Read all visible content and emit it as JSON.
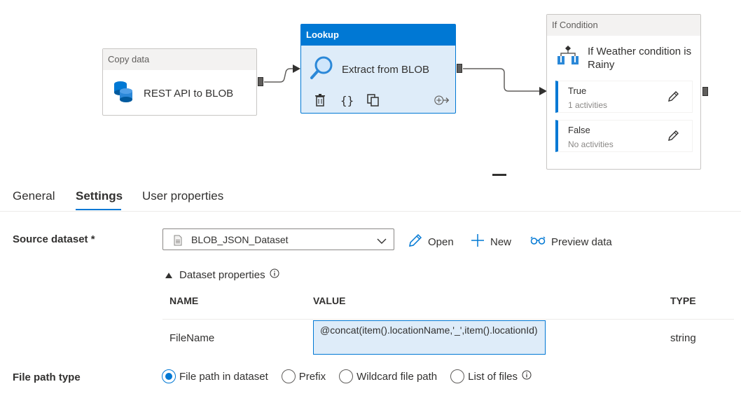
{
  "canvas": {
    "copy_node": {
      "header": "Copy data",
      "title": "REST API to BLOB",
      "icon": "database-copy-icon"
    },
    "lookup_node": {
      "header": "Lookup",
      "title": "Extract from BLOB",
      "icon": "magnifier-icon",
      "actions": [
        "delete-icon",
        "code-icon",
        "copy-icon",
        "add-output-icon"
      ]
    },
    "if_node": {
      "header": "If Condition",
      "title": "If Weather condition is Rainy",
      "icon": "if-condition-icon",
      "branches": [
        {
          "label": "True",
          "sub": "1 activities"
        },
        {
          "label": "False",
          "sub": "No activities"
        }
      ]
    },
    "accent_color": "#0078d4"
  },
  "tabs": [
    {
      "label": "General",
      "active": false
    },
    {
      "label": "Settings",
      "active": true
    },
    {
      "label": "User properties",
      "active": false
    }
  ],
  "settings": {
    "source_label": "Source dataset *",
    "dataset_value": "BLOB_JSON_Dataset",
    "open_label": "Open",
    "new_label": "New",
    "preview_label": "Preview data",
    "ds_props_label": "Dataset properties",
    "columns": {
      "name": "NAME",
      "value": "VALUE",
      "type": "TYPE"
    },
    "row": {
      "name": "FileName",
      "value": "@concat(item().locationName,'_',item().locationId)",
      "type": "string"
    },
    "file_path_label": "File path type",
    "file_path_options": [
      {
        "label": "File path in dataset",
        "checked": true
      },
      {
        "label": "Prefix",
        "checked": false
      },
      {
        "label": "Wildcard file path",
        "checked": false
      },
      {
        "label": "List of files",
        "checked": false
      }
    ]
  }
}
